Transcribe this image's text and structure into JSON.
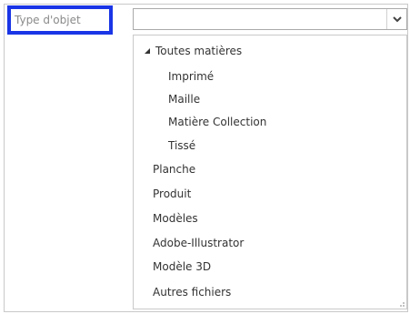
{
  "field": {
    "label": "Type d'objet",
    "value": ""
  },
  "dropdown": {
    "items": [
      {
        "label": "Toutes matières"
      },
      {
        "label": "Imprimé"
      },
      {
        "label": "Maille"
      },
      {
        "label": "Matière Collection"
      },
      {
        "label": "Tissé"
      },
      {
        "label": "Planche"
      },
      {
        "label": "Produit"
      },
      {
        "label": "Modèles"
      },
      {
        "label": "Adobe-Illustrator"
      },
      {
        "label": "Modèle 3D"
      },
      {
        "label": "Autres fichiers"
      }
    ]
  },
  "icons": {
    "dropdown_toggle": "chevron-down-icon",
    "tree_toggle": "expanded-triangle-icon",
    "resize": "resize-grip-icon"
  },
  "colors": {
    "highlight_border": "#1a35e6",
    "label_text": "#8a8a8a",
    "item_text": "#333333"
  }
}
